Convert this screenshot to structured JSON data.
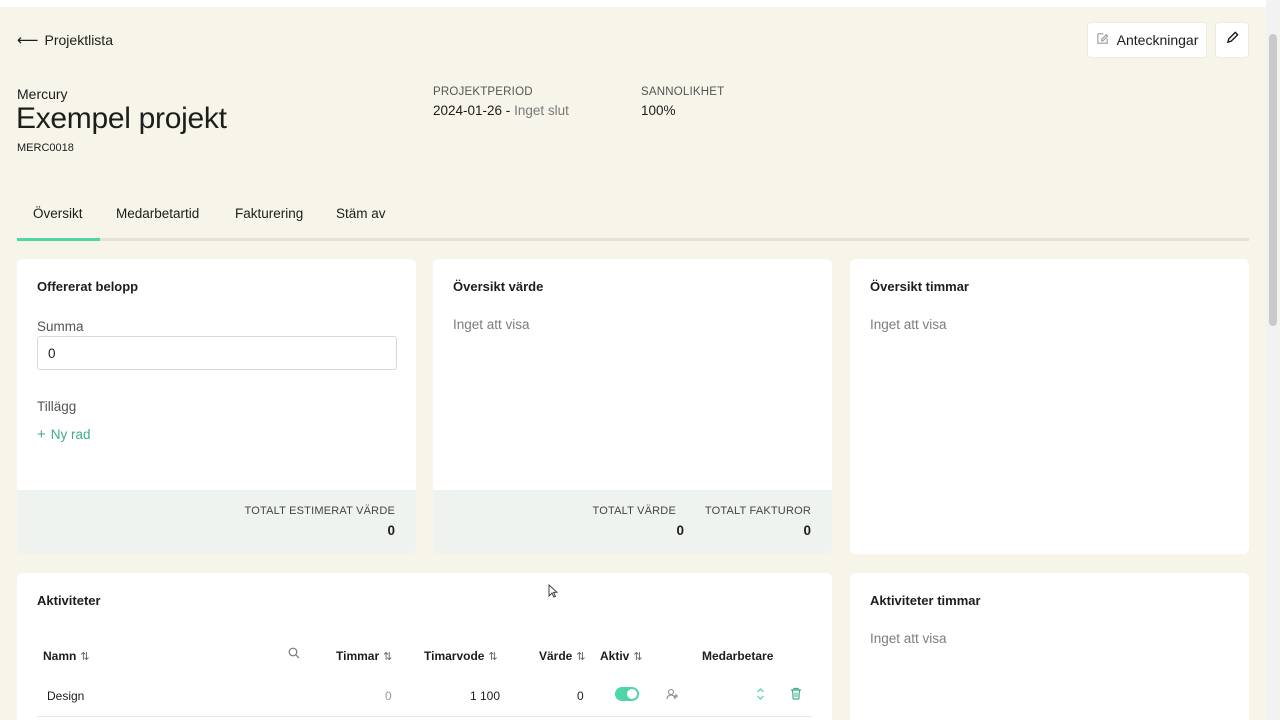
{
  "header": {
    "back_label": "Projektlista",
    "notes_label": "Anteckningar"
  },
  "project": {
    "client": "Mercury",
    "title": "Exempel projekt",
    "code": "MERC0018",
    "period_label": "PROJEKTPERIOD",
    "period_start": "2024-01-26 - ",
    "period_end": "Inget slut",
    "probability_label": "SANNOLIKHET",
    "probability_value": "100%"
  },
  "tabs": [
    {
      "label": "Översikt",
      "active": true
    },
    {
      "label": "Medarbetartid"
    },
    {
      "label": "Fakturering"
    },
    {
      "label": "Stäm av"
    }
  ],
  "offer_card": {
    "title": "Offererat belopp",
    "sum_label": "Summa",
    "sum_value": "0",
    "addition_label": "Tillägg",
    "new_row_label": "Ny rad",
    "total_label": "TOTALT ESTIMERAT VÄRDE",
    "total_value": "0"
  },
  "value_card": {
    "title": "Översikt värde",
    "empty": "Inget att visa",
    "total_value_label": "TOTALT VÄRDE",
    "total_value": "0",
    "total_invoices_label": "TOTALT FAKTUROR",
    "total_invoices": "0"
  },
  "hours_card": {
    "title": "Översikt timmar",
    "empty": "Inget att visa"
  },
  "activities": {
    "title": "Aktiviteter",
    "columns": [
      "Namn",
      "Timmar",
      "Timarvode",
      "Värde",
      "Aktiv",
      "Medarbetare"
    ],
    "rows": [
      {
        "name": "Design",
        "hours": "0",
        "rate": "1 100",
        "value": "0",
        "active": true
      }
    ]
  },
  "activities_hours": {
    "title": "Aktiviteter timmar",
    "empty": "Inget att visa"
  },
  "colors": {
    "accent": "#4fd6a6",
    "link": "#3fae84",
    "background": "#f7f4ea",
    "footer": "#eef3f0"
  }
}
